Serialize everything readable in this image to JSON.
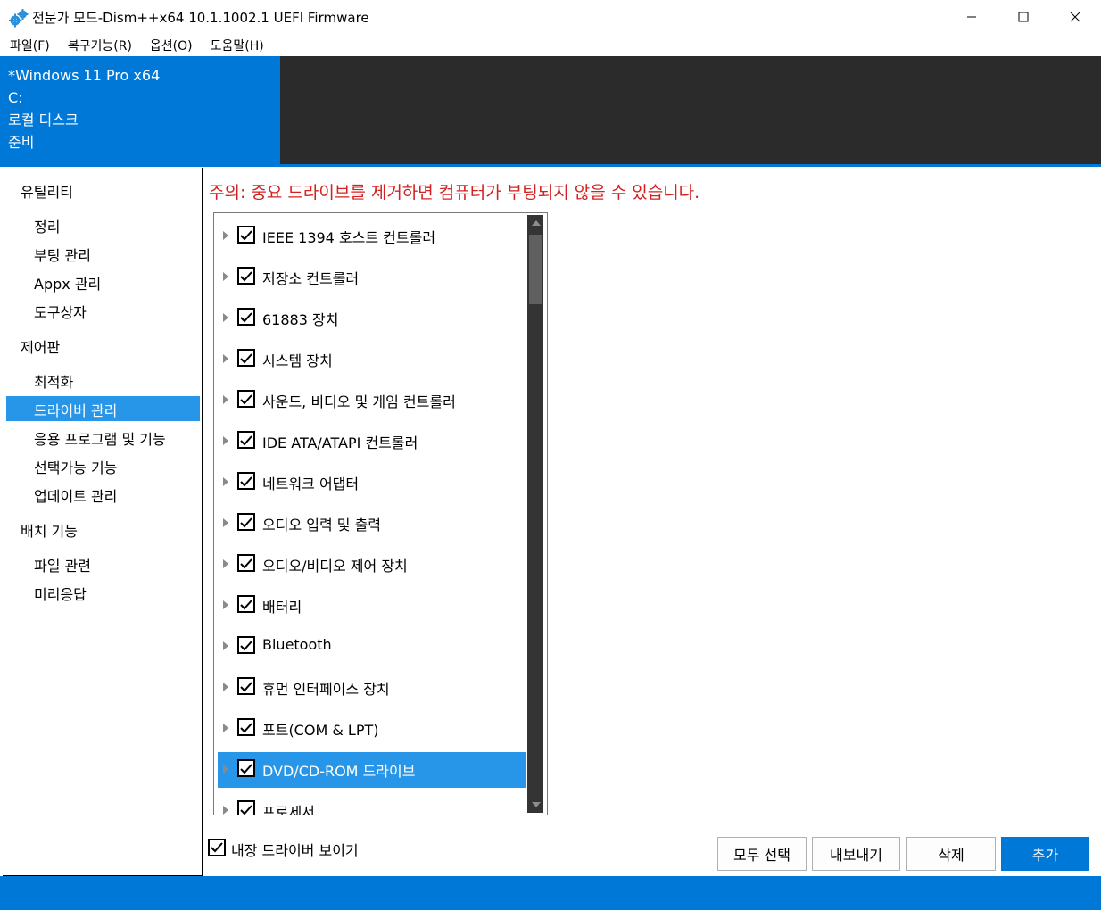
{
  "window": {
    "title": "전문가 모드-Dism++x64 10.1.1002.1 UEFI Firmware",
    "icon": "gear-icon"
  },
  "menu": {
    "items": [
      "파일(F)",
      "복구기능(R)",
      "옵션(O)",
      "도움말(H)"
    ]
  },
  "header": {
    "os": "*Windows 11 Pro x64",
    "drive": "C:",
    "disk": "로컬 디스크",
    "status": "준비"
  },
  "sidebar": {
    "groups": [
      {
        "label": "유틸리티",
        "items": [
          "정리",
          "부팅 관리",
          "Appx 관리",
          "도구상자"
        ]
      },
      {
        "label": "제어판",
        "items": [
          "최적화",
          "드라이버 관리",
          "응용 프로그램 및 기능",
          "선택가능 기능",
          "업데이트 관리"
        ]
      },
      {
        "label": "배치 기능",
        "items": [
          "파일 관련",
          "미리응답"
        ]
      }
    ],
    "active_item": "드라이버 관리"
  },
  "main": {
    "warning": "주의: 중요 드라이브를 제거하면 컴퓨터가 부팅되지 않을 수 있습니다.",
    "drivers": [
      {
        "label": "IEEE 1394 호스트 컨트롤러",
        "checked": true
      },
      {
        "label": "저장소 컨트롤러",
        "checked": true
      },
      {
        "label": "61883 장치",
        "checked": true
      },
      {
        "label": "시스템 장치",
        "checked": true
      },
      {
        "label": "사운드, 비디오 및 게임 컨트롤러",
        "checked": true
      },
      {
        "label": "IDE ATA/ATAPI 컨트롤러",
        "checked": true
      },
      {
        "label": "네트워크 어댑터",
        "checked": true
      },
      {
        "label": "오디오 입력 및 출력",
        "checked": true
      },
      {
        "label": "오디오/비디오 제어 장치",
        "checked": true
      },
      {
        "label": "배터리",
        "checked": true
      },
      {
        "label": "Bluetooth",
        "checked": true
      },
      {
        "label": "휴먼 인터페이스 장치",
        "checked": true
      },
      {
        "label": "포트(COM & LPT)",
        "checked": true
      },
      {
        "label": "DVD/CD-ROM 드라이브",
        "checked": true,
        "selected": true
      },
      {
        "label": "프로세서",
        "checked": true
      }
    ],
    "show_builtin_label": "내장 드라이버 보이기",
    "show_builtin_checked": true,
    "buttons": {
      "select_all": "모두 선택",
      "export": "내보내기",
      "delete": "삭제",
      "add": "추가"
    }
  },
  "colors": {
    "accent": "#0078d7",
    "selection": "#2896e8",
    "warning": "#d32020",
    "header_dark": "#2b2b2b"
  }
}
